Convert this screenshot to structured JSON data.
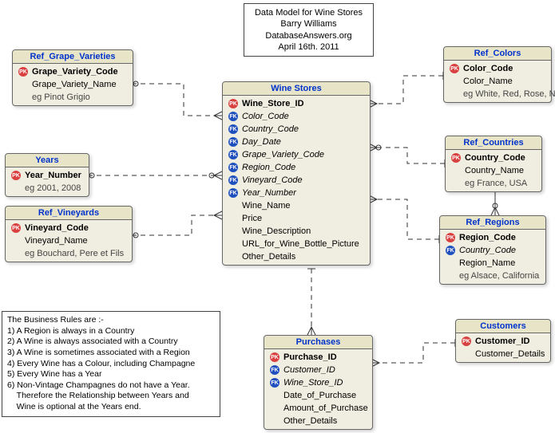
{
  "title_box": {
    "line1": "Data Model for Wine Stores",
    "line2": "Barry Williams",
    "line3": "DatabaseAnswers.org",
    "line4": "April 16th. 2011"
  },
  "entities": {
    "grape": {
      "title": "Ref_Grape_Varieties",
      "pk": "Grape_Variety_Code",
      "attr": "Grape_Variety_Name",
      "eg": "eg Pinot Grigio"
    },
    "years": {
      "title": "Years",
      "pk": "Year_Number",
      "eg": "eg 2001, 2008"
    },
    "vineyards": {
      "title": "Ref_Vineyards",
      "pk": "Vineyard_Code",
      "attr": "Vineyard_Name",
      "eg": "eg Bouchard, Pere et Fils"
    },
    "colors": {
      "title": "Ref_Colors",
      "pk": "Color_Code",
      "attr": "Color_Name",
      "eg": "eg White, Red, Rose, N/A"
    },
    "countries": {
      "title": "Ref_Countries",
      "pk": "Country_Code",
      "attr": "Country_Name",
      "eg": "eg France, USA"
    },
    "regions": {
      "title": "Ref_Regions",
      "pk": "Region_Code",
      "fk": "Country_Code",
      "attr": "Region_Name",
      "eg": "eg Alsace,  California"
    },
    "customers": {
      "title": "Customers",
      "pk": "Customer_ID",
      "attr": "Customer_Details"
    },
    "wine_stores": {
      "title": "Wine Stores",
      "pk": "Wine_Store_ID",
      "fk1": "Color_Code",
      "fk2": "Country_Code",
      "fk3": "Day_Date",
      "fk4": "Grape_Variety_Code",
      "fk5": "Region_Code",
      "fk6": "Vineyard_Code",
      "fk7": "Year_Number",
      "a1": "Wine_Name",
      "a2": "Price",
      "a3": "Wine_Description",
      "a4": "URL_for_Wine_Bottle_Picture",
      "a5": "Other_Details"
    },
    "purchases": {
      "title": "Purchases",
      "pk": "Purchase_ID",
      "fk1": "Customer_ID",
      "fk2": "Wine_Store_ID",
      "a1": "Date_of_Purchase",
      "a2": "Amount_of_Purchase",
      "a3": "Other_Details"
    }
  },
  "rules": {
    "heading": "The Business Rules are :-",
    "r1": "1) A Region is always in a Country",
    "r2": "2) A Wine is always associated with a Country",
    "r3": "3) A Wine is sometimes associated with a Region",
    "r4": "4) Every Wine has a Colour, including Champagne",
    "r5": "5) Every Wine has a Year",
    "r6a": "6) Non-Vintage Champagnes do not have a Year.",
    "r6b": "    Therefore the Relationship between Years and",
    "r6c": "    Wine is optional at the Years end."
  }
}
